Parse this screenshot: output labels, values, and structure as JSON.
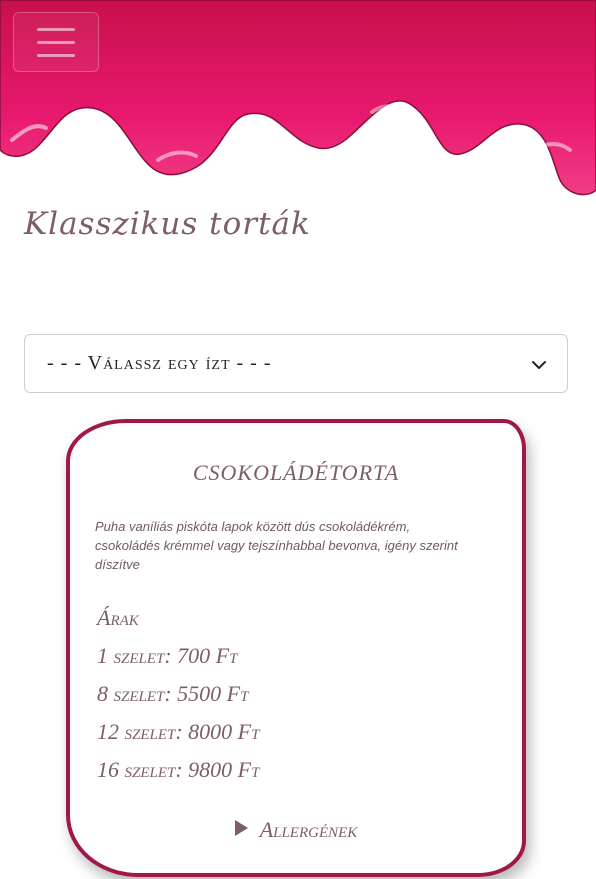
{
  "header": {
    "menu_icon": "hamburger-menu-icon",
    "accent_color": "#e8196f"
  },
  "main": {
    "title": "Klasszikus torták"
  },
  "flavor_select": {
    "selected": "- - - Válassz egy ízt - - -",
    "icon": "chevron-down-icon"
  },
  "card": {
    "title": "csokoládétorta",
    "description": "Puha vaníliás piskóta lapok között dús csokoládékrém, csokoládés krémmel vagy tejszínhabbal bevonva, igény szerint díszítve",
    "prices_heading": "Árak",
    "prices": [
      "1 szelet: 700 Ft",
      "8 szelet: 5500 Ft",
      "12 szelet: 8000 Ft",
      "16 szelet: 9800 Ft"
    ],
    "allergens_label": "Allergének",
    "border_color": "#a0174c"
  }
}
